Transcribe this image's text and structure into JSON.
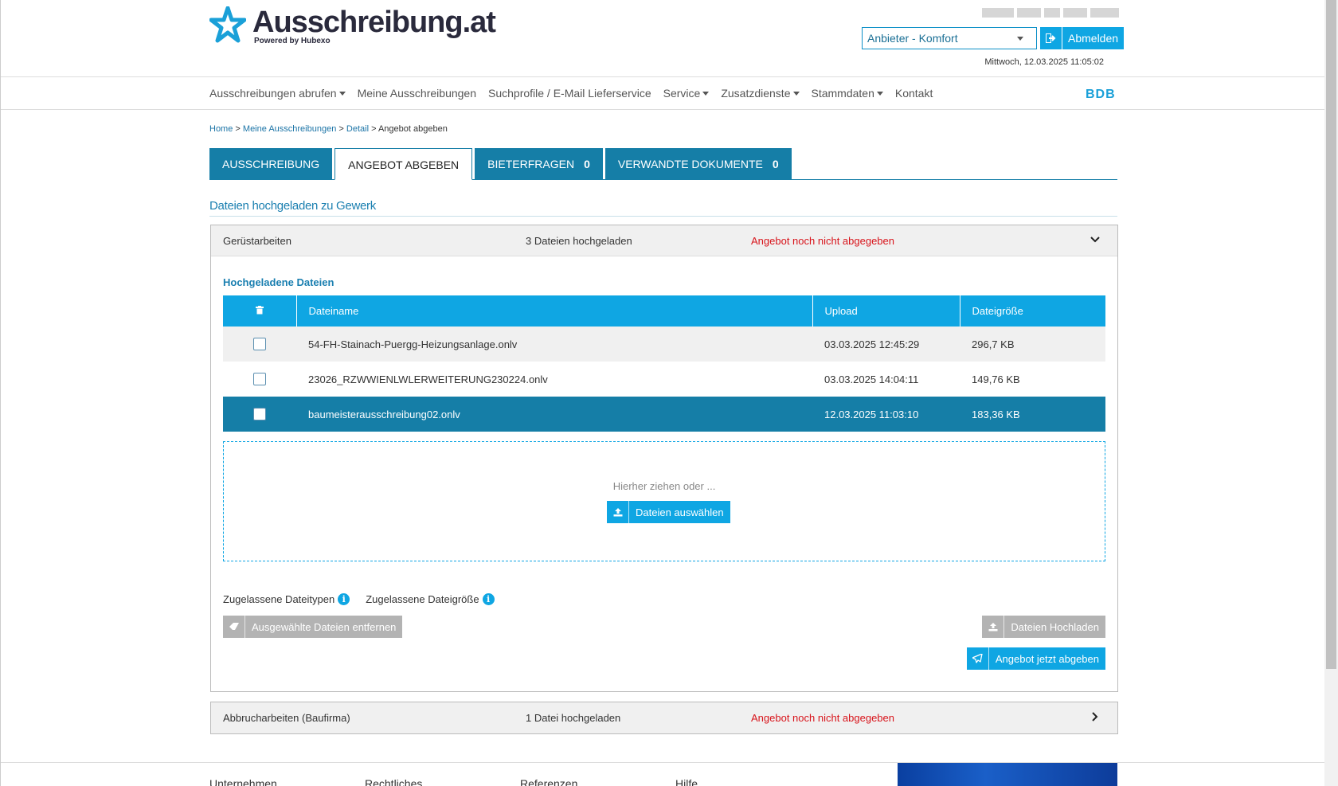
{
  "brand": {
    "name": "Ausschreibung.at",
    "tagline": "Powered by Hubexo",
    "short": "BDB"
  },
  "header": {
    "role_select": "Anbieter - Komfort",
    "logout_label": "Abmelden",
    "datetime": "Mittwoch, 12.03.2025 11:05:02"
  },
  "nav": {
    "items": [
      {
        "label": "Ausschreibungen abrufen",
        "dropdown": true
      },
      {
        "label": "Meine Ausschreibungen",
        "dropdown": false
      },
      {
        "label": "Suchprofile / E-Mail Lieferservice",
        "dropdown": false
      },
      {
        "label": "Service",
        "dropdown": true
      },
      {
        "label": "Zusatzdienste",
        "dropdown": true
      },
      {
        "label": "Stammdaten",
        "dropdown": true
      },
      {
        "label": "Kontakt",
        "dropdown": false
      }
    ]
  },
  "breadcrumb": {
    "home": "Home",
    "sep": ">",
    "mine": "Meine Ausschreibungen",
    "detail": "Detail",
    "current": "Angebot abgeben"
  },
  "tabs": [
    {
      "label": "AUSSCHREIBUNG",
      "count": ""
    },
    {
      "label": "ANGEBOT ABGEBEN",
      "count": ""
    },
    {
      "label": "BIETERFRAGEN",
      "count": "0"
    },
    {
      "label": "VERWANDTE DOKUMENTE",
      "count": "0"
    }
  ],
  "section_title": "Dateien hochgeladen zu Gewerk",
  "gewerk1": {
    "name": "Gerüstarbeiten",
    "files_count": "3 Dateien hochgeladen",
    "status": "Angebot noch nicht abgegeben",
    "uploaded_title": "Hochgeladene Dateien",
    "columns": {
      "name": "Dateiname",
      "upload": "Upload",
      "size": "Dateigröße"
    },
    "files": [
      {
        "name": "54-FH-Stainach-Puergg-Heizungsanlage.onlv",
        "upload": "03.03.2025 12:45:29",
        "size": "296,7 KB"
      },
      {
        "name": "23026_RZWWIENLWLERWEITERUNG230224.onlv",
        "upload": "03.03.2025 14:04:11",
        "size": "149,76 KB"
      },
      {
        "name": "baumeisterausschreibung02.onlv",
        "upload": "12.03.2025 11:03:10",
        "size": "183,36 KB"
      }
    ],
    "drop_hint": "Hierher ziehen oder ...",
    "choose_label": "Dateien auswählen",
    "allowed_types": "Zugelassene Dateitypen",
    "allowed_size": "Zugelassene Dateigröße",
    "remove_label": "Ausgewählte Dateien entfernen",
    "upload_label": "Dateien Hochladen",
    "submit_label": "Angebot jetzt abgeben"
  },
  "gewerk2": {
    "name": "Abbrucharbeiten (Baufirma)",
    "files_count": "1 Datei hochgeladen",
    "status": "Angebot noch nicht abgegeben"
  },
  "footer": {
    "cols": [
      "Unternehmen",
      "Rechtliches",
      "Referenzen",
      "Hilfe"
    ]
  },
  "colors": {
    "accent": "#0fa6e3",
    "dark_accent": "#157ea7",
    "status_red": "#d8141b"
  }
}
